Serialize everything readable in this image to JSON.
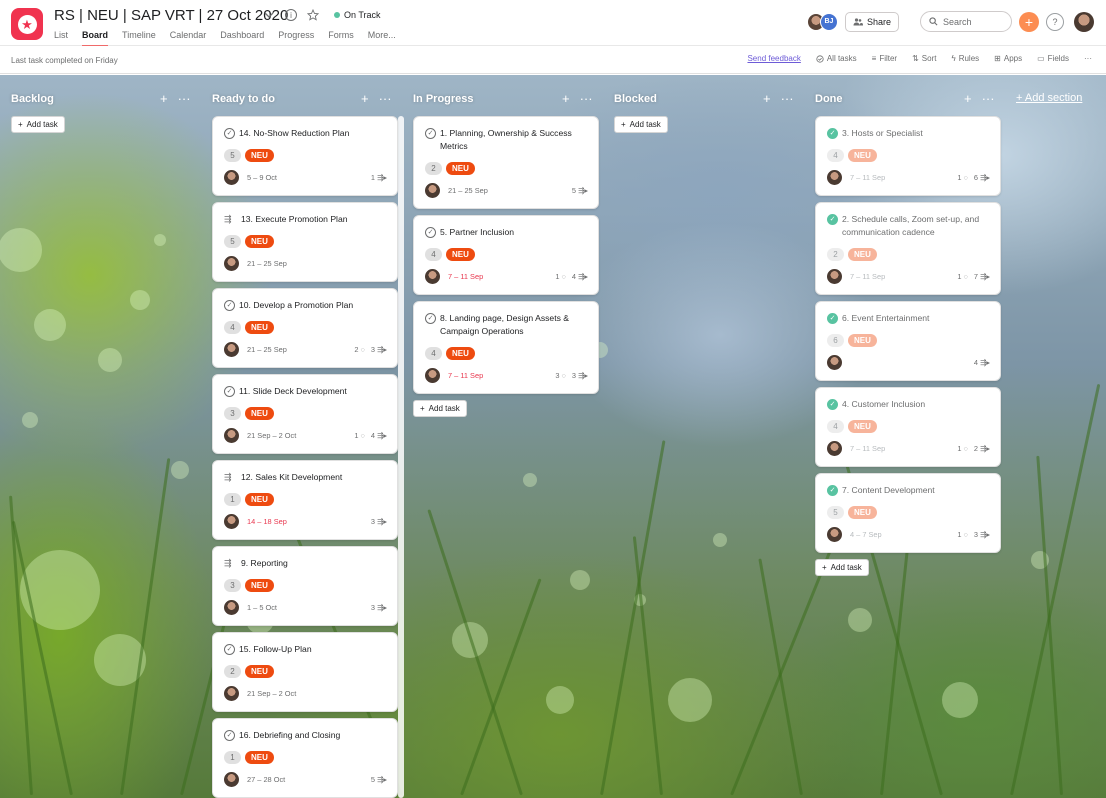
{
  "header": {
    "title": "RS | NEU | SAP VRT | 27 Oct 2020",
    "status": "On Track",
    "tabs": [
      "List",
      "Board",
      "Timeline",
      "Calendar",
      "Dashboard",
      "Progress",
      "Forms",
      "More..."
    ],
    "active_tab": "Board",
    "member_initials": "BJ",
    "share_label": "Share",
    "search_placeholder": "Search"
  },
  "toolbar": {
    "last_completed": "Last task completed on Friday",
    "feedback": "Send feedback",
    "all_tasks": "All tasks",
    "filter": "Filter",
    "sort": "Sort",
    "rules": "Rules",
    "apps": "Apps",
    "fields": "Fields"
  },
  "board": {
    "add_section": "+ Add section",
    "add_task": "Add task",
    "columns": [
      {
        "name": "Backlog",
        "cards": []
      },
      {
        "name": "Ready to do",
        "cards": [
          {
            "title": "14. No-Show Reduction Plan",
            "num": "5",
            "tag": "NEU",
            "date": "5 – 9 Oct",
            "comments": "",
            "subtasks": "1"
          },
          {
            "title": "13. Execute Promotion Plan",
            "num": "5",
            "tag": "NEU",
            "date": "21 – 25 Sep",
            "comments": "",
            "subtasks": ""
          },
          {
            "title": "10. Develop a Promotion Plan",
            "num": "4",
            "tag": "NEU",
            "date": "21 – 25 Sep",
            "comments": "2",
            "subtasks": "3"
          },
          {
            "title": "11. Slide Deck Development",
            "num": "3",
            "tag": "NEU",
            "date": "21 Sep – 2 Oct",
            "comments": "1",
            "subtasks": "4"
          },
          {
            "title": "12. Sales Kit Development",
            "num": "1",
            "tag": "NEU",
            "date": "14 – 18 Sep",
            "comments": "",
            "subtasks": "3"
          },
          {
            "title": "9. Reporting",
            "num": "3",
            "tag": "NEU",
            "date": "1 – 5 Oct",
            "comments": "",
            "subtasks": "3"
          },
          {
            "title": "15. Follow-Up Plan",
            "num": "2",
            "tag": "NEU",
            "date": "21 Sep – 2 Oct",
            "comments": "",
            "subtasks": ""
          },
          {
            "title": "16. Debriefing and Closing",
            "num": "1",
            "tag": "NEU",
            "date": "27 – 28 Oct",
            "comments": "",
            "subtasks": "5"
          }
        ]
      },
      {
        "name": "In Progress",
        "cards": [
          {
            "title": "1. Planning, Ownership & Success Metrics",
            "num": "2",
            "tag": "NEU",
            "date": "21 – 25 Sep",
            "comments": "",
            "subtasks": "5"
          },
          {
            "title": "5. Partner Inclusion",
            "num": "4",
            "tag": "NEU",
            "date": "7 – 11 Sep",
            "comments": "1",
            "subtasks": "4"
          },
          {
            "title": "8. Landing page, Design Assets & Campaign Operations",
            "num": "4",
            "tag": "NEU",
            "date": "7 – 11 Sep",
            "comments": "3",
            "subtasks": "3"
          }
        ]
      },
      {
        "name": "Blocked",
        "cards": []
      },
      {
        "name": "Done",
        "cards": [
          {
            "title": "3. Hosts or Specialist",
            "num": "4",
            "tag": "NEU",
            "date": "7 – 11 Sep",
            "comments": "1",
            "subtasks": "6"
          },
          {
            "title": "2. Schedule calls, Zoom set-up, and communication cadence",
            "num": "2",
            "tag": "NEU",
            "date": "7 – 11 Sep",
            "comments": "1",
            "subtasks": "7"
          },
          {
            "title": "6. Event Entertainment",
            "num": "6",
            "tag": "NEU",
            "date": "",
            "comments": "",
            "subtasks": "4"
          },
          {
            "title": "4. Customer Inclusion",
            "num": "4",
            "tag": "NEU",
            "date": "7 – 11 Sep",
            "comments": "1",
            "subtasks": "2"
          },
          {
            "title": "7. Content Development",
            "num": "5",
            "tag": "NEU",
            "date": "4 – 7 Sep",
            "comments": "1",
            "subtasks": "3"
          }
        ]
      }
    ]
  },
  "colors": {
    "accent": "#f06a6a",
    "neu_tag": "#ee4b10",
    "on_track": "#58c3a1",
    "late_date": "#e8384f",
    "project_icon": "#f0334f"
  },
  "icons": [
    "star-icon",
    "chevron-down-icon",
    "info-icon",
    "star-outline-icon",
    "people-icon",
    "search-icon",
    "plus-icon",
    "help-icon",
    "check-circle-icon",
    "comment-icon",
    "subtask-icon",
    "more-icon",
    "filter-icon",
    "sort-icon",
    "rules-icon",
    "apps-icon",
    "fields-icon"
  ]
}
